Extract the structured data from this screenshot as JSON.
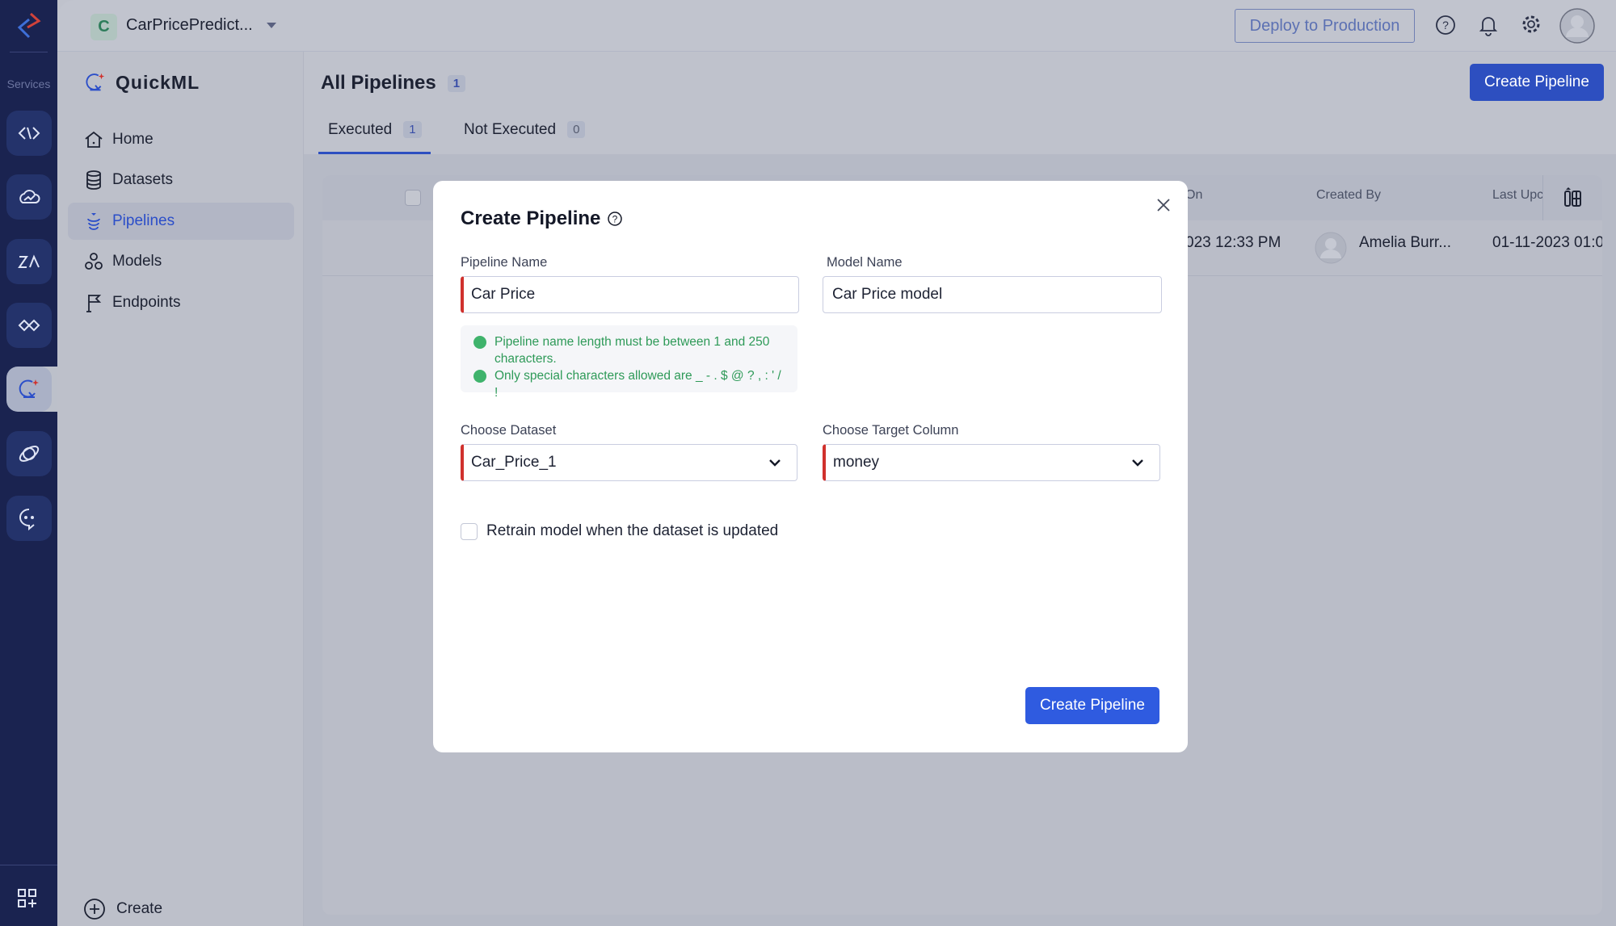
{
  "rail": {
    "services_label": "Services",
    "icons": [
      "code-brackets-icon",
      "cloud-analytics-icon",
      "zia-icon",
      "integration-icon",
      "quickml-icon",
      "orbit-icon",
      "chat-bot-icon"
    ],
    "active": "quickml-icon",
    "bottom_icon": "grid-plus-icon"
  },
  "topbar": {
    "project_initial": "C",
    "project_name": "CarPricePredict...",
    "deploy_label": "Deploy to Production",
    "icons": [
      "help-icon",
      "bell-icon",
      "gear-icon",
      "avatar"
    ]
  },
  "sidenav": {
    "title": "QuickML",
    "items": [
      {
        "label": "Home",
        "icon": "home-icon"
      },
      {
        "label": "Datasets",
        "icon": "database-icon"
      },
      {
        "label": "Pipelines",
        "icon": "pipeline-icon",
        "active": true
      },
      {
        "label": "Models",
        "icon": "models-icon"
      },
      {
        "label": "Endpoints",
        "icon": "flag-icon"
      }
    ],
    "create_label": "Create"
  },
  "main": {
    "title": "All Pipelines",
    "count": "1",
    "create_button": "Create Pipeline",
    "tabs": [
      {
        "label": "Executed",
        "count": "1",
        "active": true
      },
      {
        "label": "Not Executed",
        "count": "0"
      }
    ],
    "table": {
      "headers": [
        "On",
        "Created By",
        "Last Upc"
      ],
      "rows": [
        {
          "created_on": "023 12:33 PM",
          "created_by": "Amelia Burr...",
          "last_updated": "01-11-2023 01:0"
        }
      ]
    }
  },
  "modal": {
    "title": "Create Pipeline",
    "pipeline_name_label": "Pipeline Name",
    "pipeline_name_value": "Car Price",
    "model_name_label": "Model Name",
    "model_name_value": "Car Price model",
    "validation": [
      "Pipeline name length must be between 1 and 250 characters.",
      "Only special characters allowed are _ - . $ @ ? , : ' / !"
    ],
    "dataset_label": "Choose Dataset",
    "dataset_value": "Car_Price_1",
    "target_label": "Choose Target Column",
    "target_value": "money",
    "retrain_label": "Retrain model when the dataset is updated",
    "retrain_checked": false,
    "submit_label": "Create Pipeline"
  },
  "colors": {
    "accent": "#2f5be0",
    "required": "#d0312d",
    "valid": "#2e9a58",
    "rail": "#1a2350"
  }
}
